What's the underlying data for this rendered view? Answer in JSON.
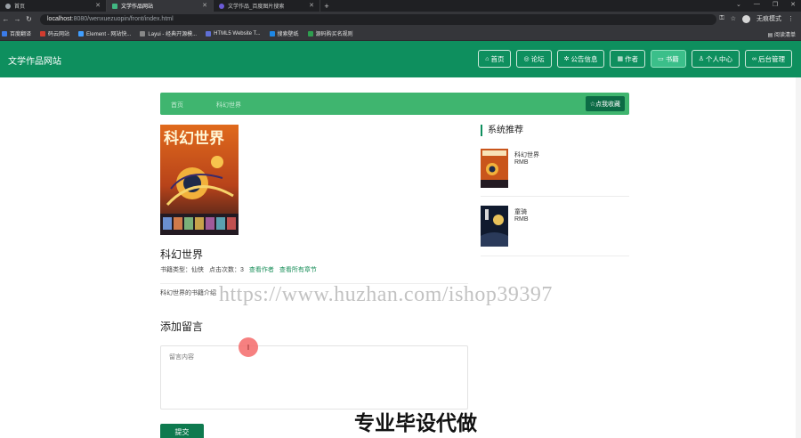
{
  "browser": {
    "tabs": [
      {
        "label": "首页",
        "active": false,
        "icon": "globe-icon"
      },
      {
        "label": "文学作品网站",
        "active": true,
        "icon": "vue-icon"
      },
      {
        "label": "文学作品_百度图片搜索",
        "active": false,
        "icon": "baidu-icon"
      }
    ],
    "url_host": "localhost",
    "url_path": ":8080/wenxuezuopin/front/index.html",
    "profile_label": "无痕模式",
    "bookmarks": [
      "百度翻译",
      "码云网站",
      "Element - 网站快...",
      "Layui - 经典开源模...",
      "HTML5 Website T...",
      "搜索壁纸",
      "源码购买名规则"
    ],
    "reading_list": "阅读清单"
  },
  "site": {
    "title": "文学作品网站",
    "nav": [
      {
        "label": "首页",
        "icon": "home-icon",
        "active": false
      },
      {
        "label": "论坛",
        "icon": "forum-icon",
        "active": false
      },
      {
        "label": "公告信息",
        "icon": "notice-icon",
        "active": false
      },
      {
        "label": "作者",
        "icon": "author-icon",
        "active": false
      },
      {
        "label": "书籍",
        "icon": "book-icon",
        "active": true
      },
      {
        "label": "个人中心",
        "icon": "user-icon",
        "active": false
      },
      {
        "label": "后台管理",
        "icon": "link-icon",
        "active": false
      }
    ]
  },
  "crumb": {
    "home": "首页",
    "current": "科幻世界",
    "favorite_label": "点我收藏"
  },
  "book": {
    "cover_text": "科幻世界",
    "title": "科幻世界",
    "type_label": "书籍类型：",
    "type_value": "仙侠",
    "clicks_label": "点击次数：",
    "clicks_value": "3",
    "view_author": "查看作者",
    "view_chapters": "查看所有章节",
    "description": "科幻世界的书籍介绍"
  },
  "comment": {
    "title": "添加留言",
    "placeholder": "留言内容",
    "submit_label": "提交"
  },
  "recommend": {
    "title": "系统推荐",
    "items": [
      {
        "name": "科幻世界",
        "price": "RMB"
      },
      {
        "name": "童骑",
        "price": "RMB"
      }
    ]
  },
  "overlay": {
    "watermark": "https://www.huzhan.com/ishop39397",
    "caption": "专业毕设代做",
    "cursor_glyph": "I"
  },
  "colors": {
    "header_green": "#0e8f5e",
    "crumb_green": "#3fb56f",
    "accent_dark_green": "#0c6b45"
  }
}
